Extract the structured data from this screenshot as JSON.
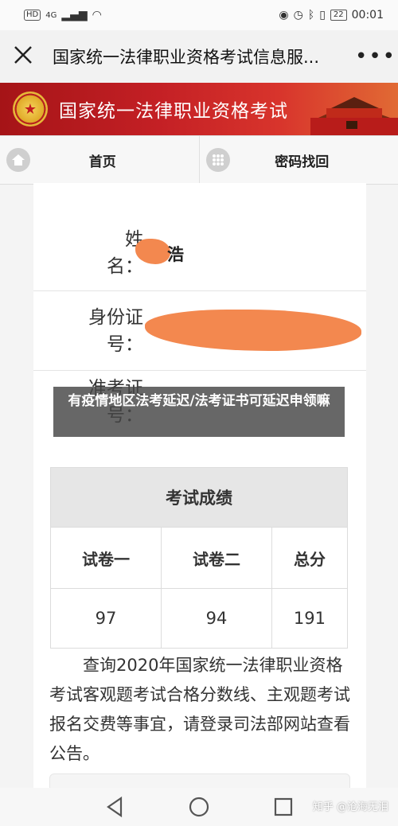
{
  "status_bar": {
    "network": "HD",
    "signal": "4G",
    "battery": "22",
    "time": "00:01"
  },
  "title_bar": {
    "close_icon": "close-icon",
    "title": "国家统一法律职业资格考试信息服...",
    "more_icon": "more-icon"
  },
  "banner": {
    "title": "国家统一法律职业资格考试"
  },
  "nav": {
    "home": "首页",
    "password": "密码找回"
  },
  "form": {
    "name_label_1": "姓",
    "name_label_2": "名：",
    "name_value": "浩",
    "id_label_1": "身份证",
    "id_label_2": "号：",
    "ticket_label_1": "准考证",
    "ticket_label_2": "号："
  },
  "caption": {
    "text": "有疫情地区法考延迟/法考证书可延迟申领嘛"
  },
  "scores": {
    "title": "考试成绩",
    "headers": [
      "试卷一",
      "试卷二",
      "总分"
    ],
    "values": [
      "97",
      "94",
      "191"
    ]
  },
  "notice": {
    "text": "查询2020年国家统一法律职业资格考试客观题考试合格分数线、主观题考试报名交费等事宜，请登录司法部网站查看公告。"
  },
  "watermark": {
    "text": "知乎 @沧海无泪"
  },
  "colors": {
    "banner_red": "#c42025",
    "redaction": "#f3884f",
    "table_header": "#e6e6e6"
  }
}
